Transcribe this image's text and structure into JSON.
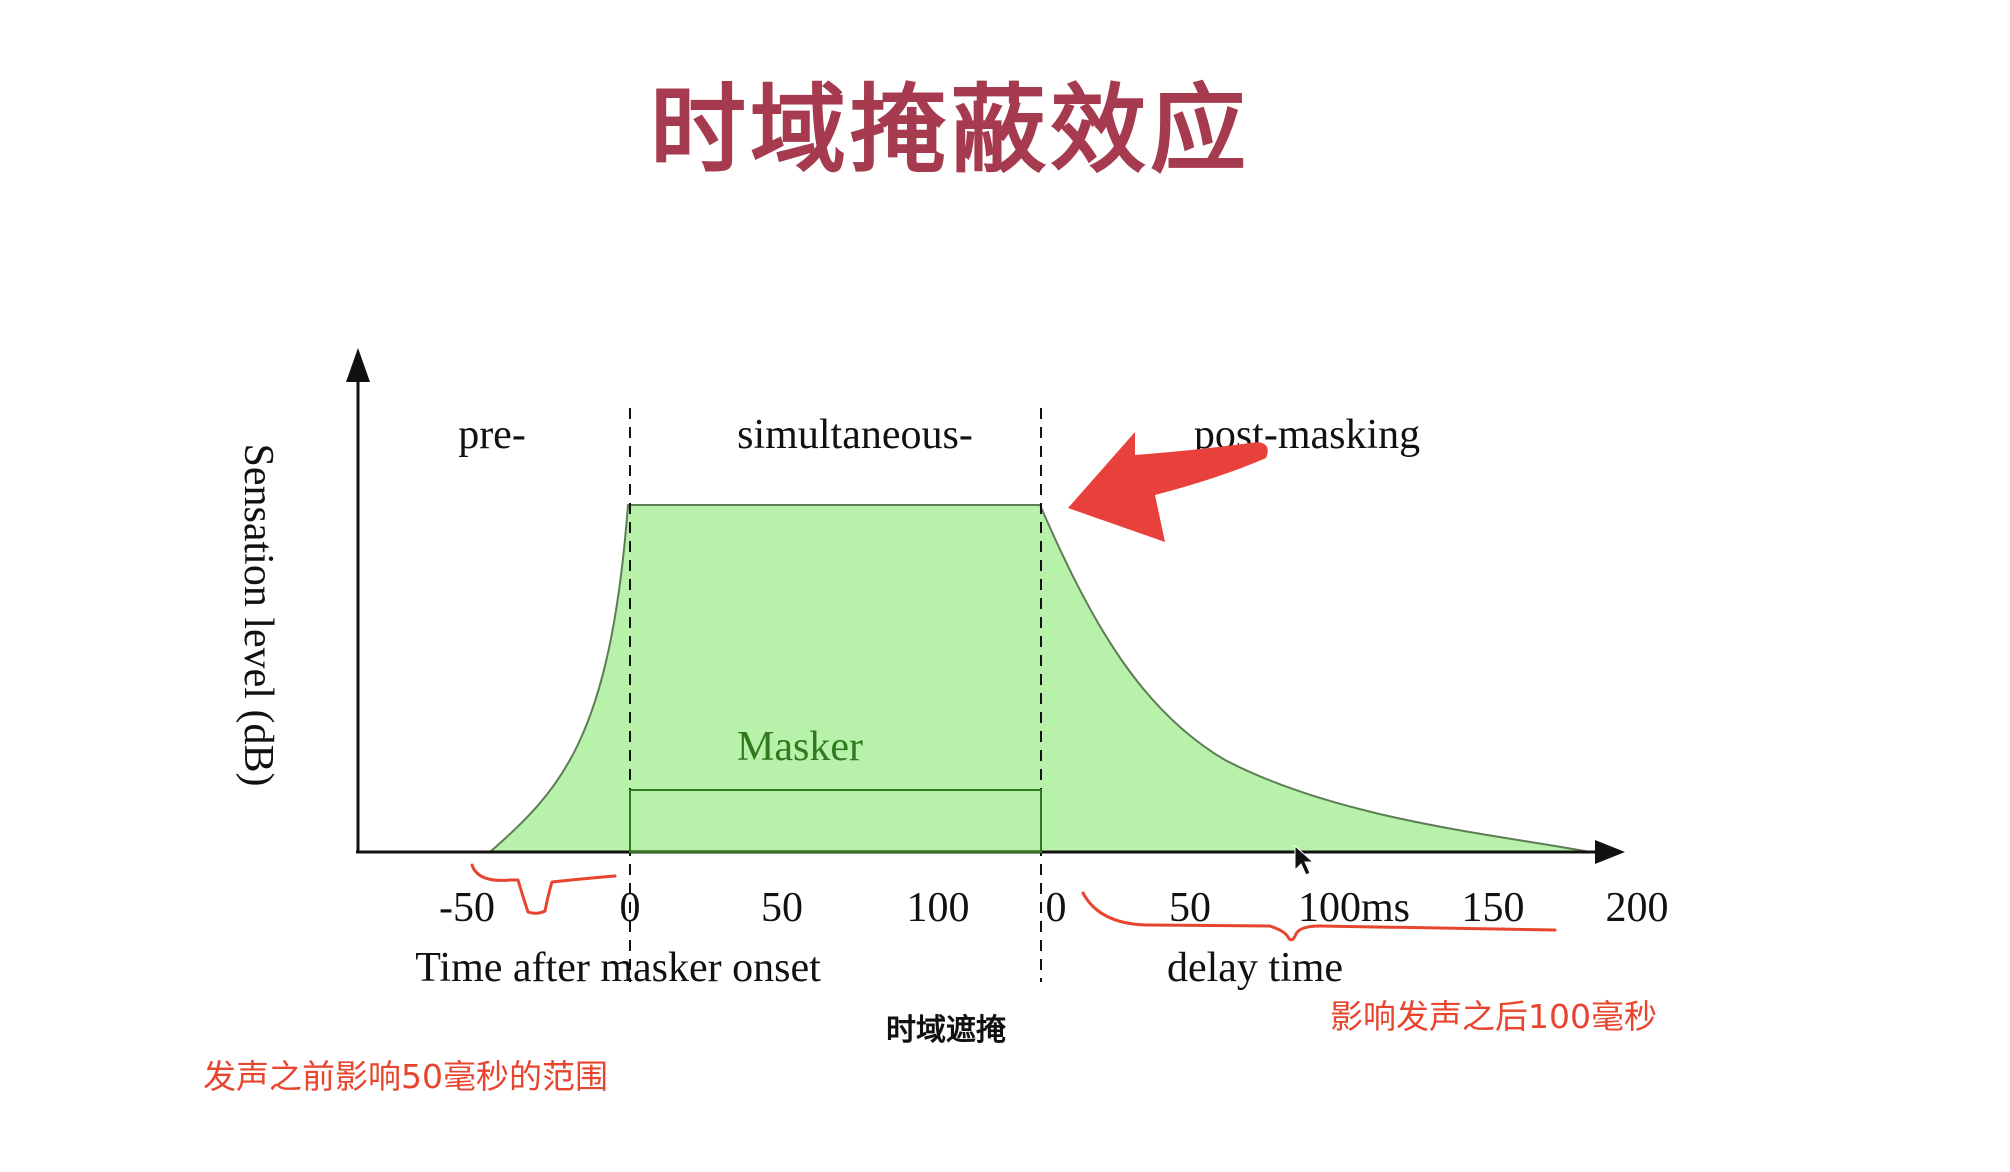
{
  "page": {
    "title": "时域掩蔽效应"
  },
  "diagram": {
    "y_axis_label": "Sensation level (dB)",
    "regions": {
      "pre": "pre-",
      "simultaneous": "simultaneous-",
      "post": "post-masking"
    },
    "masker_label": "Masker",
    "caption": "时域遮掩",
    "axis_left": {
      "title": "Time after masker onset",
      "ticks": [
        "-50",
        "0",
        "50",
        "100"
      ]
    },
    "axis_right": {
      "title": "delay time",
      "ticks": [
        "0",
        "50",
        "100ms",
        "150",
        "200"
      ]
    }
  },
  "annotations": {
    "left_note": "发声之前影响50毫秒的范围",
    "right_note": "影响发声之后100毫秒"
  },
  "colors": {
    "title": "#a63b4f",
    "fill": "#b8f1a9",
    "masker_box": "#2f7a1e",
    "arrow": "#e8413c",
    "annotation": "#e8452f"
  }
}
